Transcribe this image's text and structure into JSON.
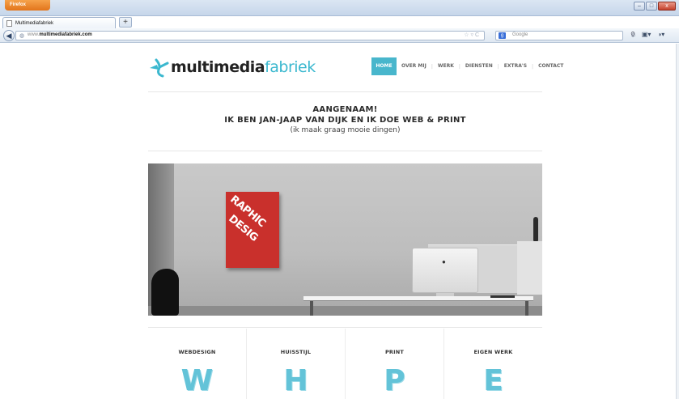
{
  "browser": {
    "menu_button": "Firefox",
    "tab_title": "Multimediafabriek",
    "new_tab": "+",
    "url_prefix": "www.",
    "url_domain": "multimediafabriek.com",
    "search_placeholder": "Google",
    "window_controls": [
      "–",
      "□",
      "x"
    ]
  },
  "site": {
    "logo": {
      "word1": "multimedia",
      "word2": "fabriek"
    },
    "nav": [
      "HOME",
      "OVER MIJ",
      "WERK",
      "DIENSTEN",
      "EXTRA'S",
      "CONTACT"
    ],
    "intro": {
      "line1": "AANGENAAM!",
      "line2": "IK BEN JAN-JAAP VAN DIJK EN IK DOE WEB & PRINT",
      "line3": "(ik maak graag mooie dingen)"
    },
    "hero_poster_text": [
      "RAPHIC",
      "DESIG"
    ],
    "services": [
      {
        "name": "WEBDESIGN",
        "letter": "W"
      },
      {
        "name": "HUISSTIJL",
        "letter": "H"
      },
      {
        "name": "PRINT",
        "letter": "P"
      },
      {
        "name": "EIGEN WERK",
        "letter": "E"
      }
    ]
  },
  "colors": {
    "accent": "#48b6cc",
    "poster": "#c9302c"
  }
}
